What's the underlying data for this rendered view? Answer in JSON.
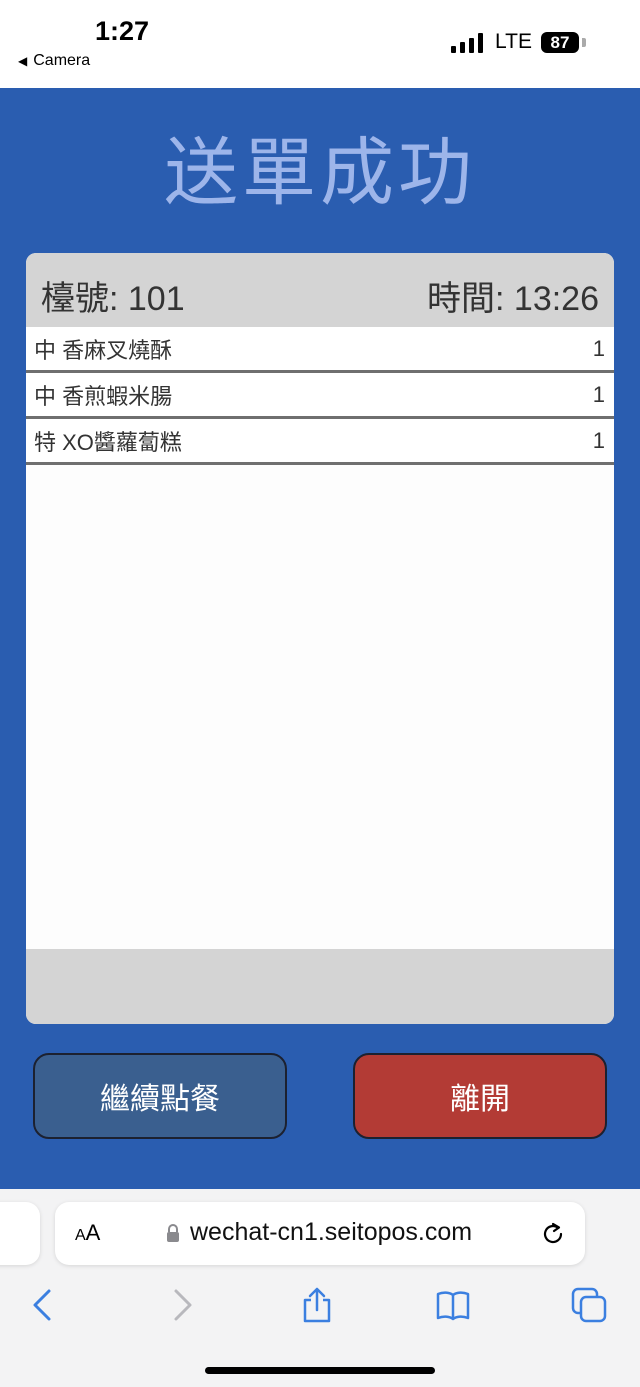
{
  "status_bar": {
    "time": "1:27",
    "back_app": "Camera",
    "network": "LTE",
    "battery": "87"
  },
  "page": {
    "title": "送單成功",
    "table_no_label": "檯號: 101",
    "time_label": "時間: 13:26",
    "items": [
      {
        "name": "中 香麻叉燒酥",
        "qty": "1"
      },
      {
        "name": "中 香煎蝦米腸",
        "qty": "1"
      },
      {
        "name": "特 XO醬蘿蔔糕",
        "qty": "1"
      }
    ],
    "continue_label": "繼續點餐",
    "leave_label": "離開",
    "colors": {
      "background": "#2a5db0",
      "title": "#9db5ea",
      "continue_button": "#3a5f8f",
      "leave_button": "#b33b35"
    }
  },
  "browser": {
    "aa_label_small": "A",
    "aa_label_large": "A",
    "url": "wechat-cn1.seitopos.com",
    "toolbar_icons": [
      "back-icon",
      "forward-icon",
      "share-icon",
      "bookmarks-icon",
      "tabs-icon"
    ]
  }
}
